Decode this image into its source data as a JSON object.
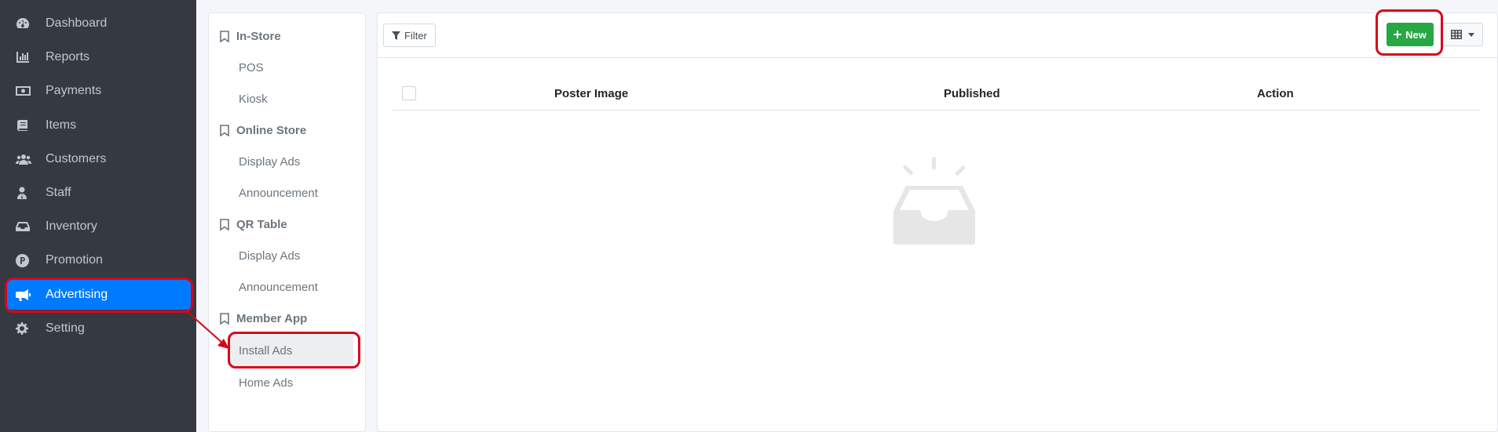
{
  "sidebar": {
    "items": [
      {
        "label": "Dashboard",
        "icon": "dashboard-icon"
      },
      {
        "label": "Reports",
        "icon": "bar-chart-icon"
      },
      {
        "label": "Payments",
        "icon": "money-bill-icon"
      },
      {
        "label": "Items",
        "icon": "book-icon"
      },
      {
        "label": "Customers",
        "icon": "users-icon"
      },
      {
        "label": "Staff",
        "icon": "user-tie-icon"
      },
      {
        "label": "Inventory",
        "icon": "inbox-icon"
      },
      {
        "label": "Promotion",
        "icon": "promotion-p-icon"
      },
      {
        "label": "Advertising",
        "icon": "megaphone-icon",
        "active": true
      },
      {
        "label": "Setting",
        "icon": "gear-icon"
      }
    ]
  },
  "submenu": {
    "sections": [
      {
        "title": "In-Store",
        "links": [
          "POS",
          "Kiosk"
        ]
      },
      {
        "title": "Online Store",
        "links": [
          "Display Ads",
          "Announcement"
        ]
      },
      {
        "title": "QR Table",
        "links": [
          "Display Ads",
          "Announcement"
        ]
      },
      {
        "title": "Member App",
        "links": [
          "Install Ads",
          "Home Ads"
        ]
      }
    ],
    "active_link": "Install Ads"
  },
  "toolbar": {
    "filter_label": "Filter",
    "new_label": "New"
  },
  "table": {
    "columns": [
      "Poster Image",
      "Published",
      "Action"
    ],
    "rows": []
  },
  "colors": {
    "sidebar_bg": "#343a40",
    "active_blue": "#007bff",
    "new_green": "#28a745",
    "highlight_red": "#d9041b"
  }
}
